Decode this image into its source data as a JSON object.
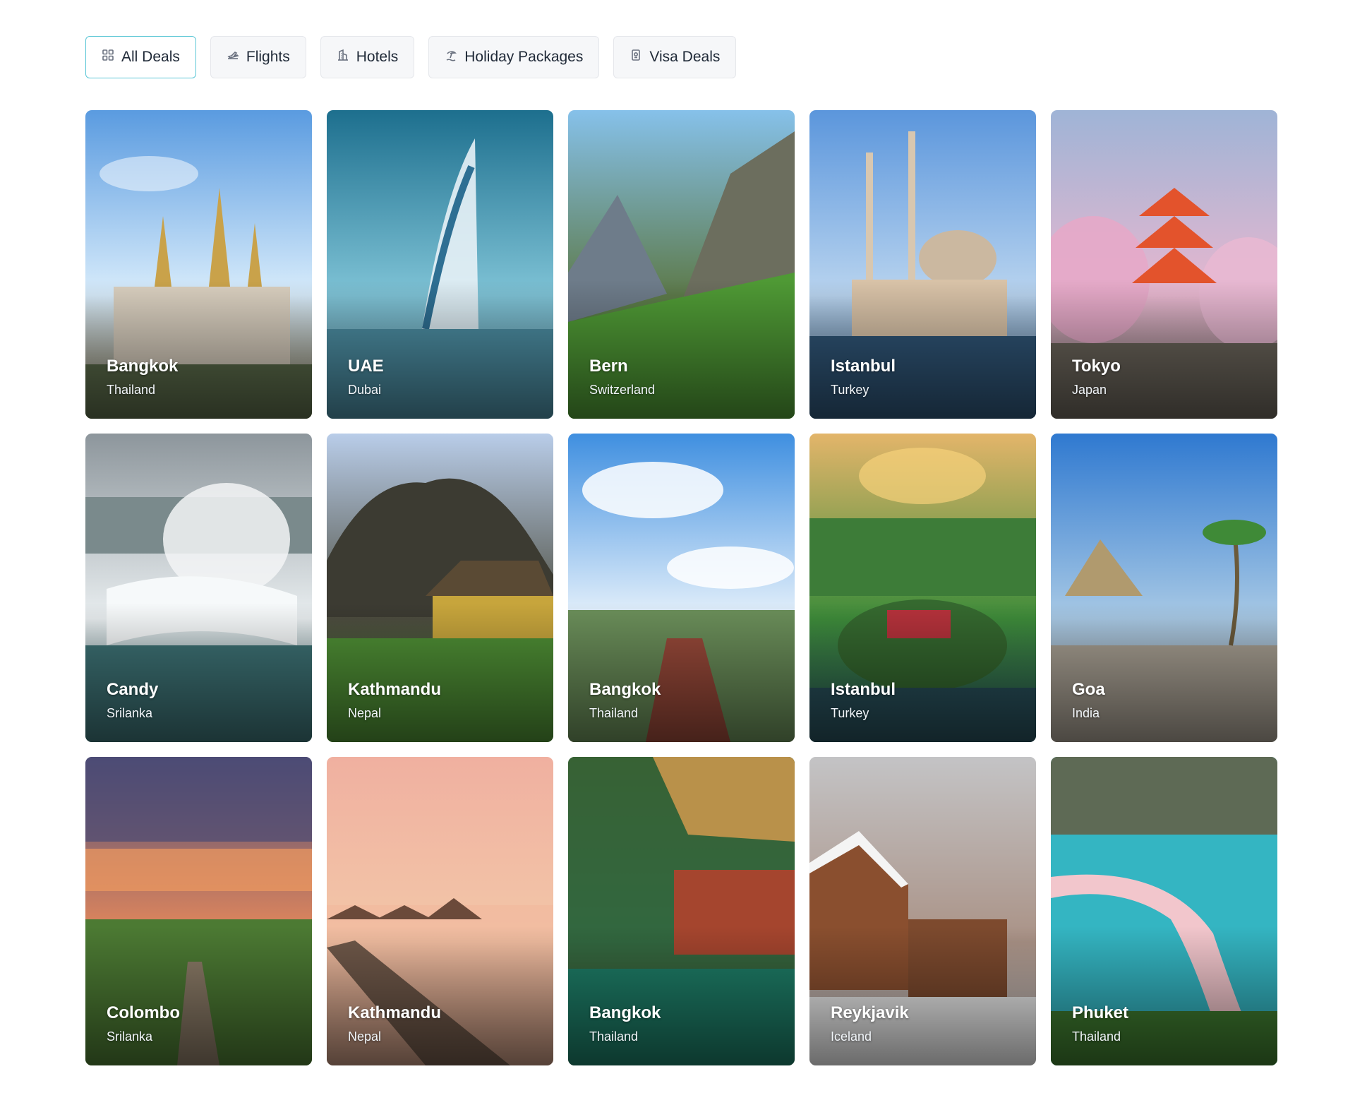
{
  "tabs": [
    {
      "label": "All Deals",
      "icon": "grid-icon",
      "active": true
    },
    {
      "label": "Flights",
      "icon": "plane-icon",
      "active": false
    },
    {
      "label": "Hotels",
      "icon": "building-icon",
      "active": false
    },
    {
      "label": "Holiday Packages",
      "icon": "beach-icon",
      "active": false
    },
    {
      "label": "Visa Deals",
      "icon": "passport-icon",
      "active": false
    }
  ],
  "deals": [
    {
      "city": "Bangkok",
      "country": "Thailand",
      "scene": "temple",
      "palette": [
        "#5a9be0",
        "#d8ecfb",
        "#8a7a52"
      ]
    },
    {
      "city": "UAE",
      "country": "Dubai",
      "scene": "tower",
      "palette": [
        "#1d6f8e",
        "#7fc3d6",
        "#5e8fa0"
      ]
    },
    {
      "city": "Bern",
      "country": "Switzerland",
      "scene": "mountain",
      "palette": [
        "#86c1ea",
        "#5d7a4a",
        "#3f8f2f"
      ]
    },
    {
      "city": "Istanbul",
      "country": "Turkey",
      "scene": "mosque",
      "palette": [
        "#5b96dc",
        "#b9d4ef",
        "#335b7e"
      ]
    },
    {
      "city": "Tokyo",
      "country": "Japan",
      "scene": "pagoda",
      "palette": [
        "#9fb4d6",
        "#e7b7cf",
        "#6e6a62"
      ]
    },
    {
      "city": "Candy",
      "country": "Srilanka",
      "scene": "falls",
      "palette": [
        "#8d969c",
        "#e9eef0",
        "#3e6f73"
      ]
    },
    {
      "city": "Kathmandu",
      "country": "Nepal",
      "scene": "cliff",
      "palette": [
        "#b9cde9",
        "#4d4d3f",
        "#4f8f35"
      ]
    },
    {
      "city": "Bangkok",
      "country": "Thailand",
      "scene": "bridge",
      "palette": [
        "#3f8fe0",
        "#e6f1fb",
        "#8a4a3a"
      ]
    },
    {
      "city": "Istanbul",
      "country": "Turkey",
      "scene": "island",
      "palette": [
        "#e3b56a",
        "#3e8c3a",
        "#2b5963"
      ]
    },
    {
      "city": "Goa",
      "country": "India",
      "scene": "beach",
      "palette": [
        "#2f79d0",
        "#a8c9e5",
        "#9b9489"
      ]
    },
    {
      "city": "Colombo",
      "country": "Srilanka",
      "scene": "sunset",
      "palette": [
        "#514e79",
        "#e98a5a",
        "#4f7f34"
      ]
    },
    {
      "city": "Kathmandu",
      "country": "Nepal",
      "scene": "overwater",
      "palette": [
        "#f0b0a0",
        "#f3c7a8",
        "#6f5849"
      ]
    },
    {
      "city": "Bangkok",
      "country": "Thailand",
      "scene": "lagoon",
      "palette": [
        "#3a6d3a",
        "#1f8a72",
        "#a4472f"
      ]
    },
    {
      "city": "Reykjavik",
      "country": "Iceland",
      "scene": "cabin",
      "palette": [
        "#c9c9cb",
        "#8a4f2f",
        "#f3f3f3"
      ]
    },
    {
      "city": "Phuket",
      "country": "Thailand",
      "scene": "coast",
      "palette": [
        "#2fb6c4",
        "#f3c3c9",
        "#3f7a2f"
      ]
    }
  ]
}
